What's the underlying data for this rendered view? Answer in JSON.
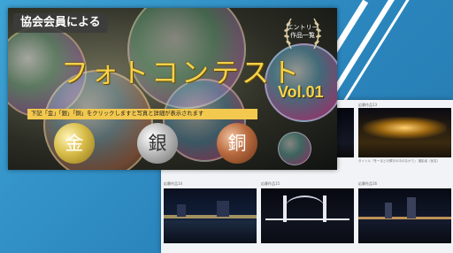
{
  "header": {
    "title": "協会会員による"
  },
  "banner": {
    "title": "フォトコンテスト",
    "vol": "Vol.01",
    "entry_badge": "エントリー作品一覧",
    "instruction": "下記「金」「銀」「銅」をクリックしますと写真と詳細が表示されます"
  },
  "medals": [
    {
      "label": "金",
      "color": "#d8bd49"
    },
    {
      "label": "銀",
      "color": "#b9b9b9"
    },
    {
      "label": "銅",
      "color": "#b86a3e"
    }
  ],
  "entries": [
    {
      "title": "応募作品11",
      "caption": "タイトル「丸の内仲通り照明の煌きで」 撮影者（仮名）",
      "scene": "street"
    },
    {
      "title": "応募作品12",
      "caption": "タイトル「都会夜景の素晴」 撮影者（仮名）",
      "scene": "city"
    },
    {
      "title": "応募作品13",
      "caption": "タイトル「冬ーまどの輝きの中のなかで」 撮影者（仮名）",
      "scene": "trees"
    },
    {
      "title": "応募作品14",
      "caption": "",
      "scene": "waterfront"
    },
    {
      "title": "応募作品15",
      "caption": "",
      "scene": "bridge"
    },
    {
      "title": "応募作品16",
      "caption": "",
      "scene": "skyline"
    }
  ]
}
